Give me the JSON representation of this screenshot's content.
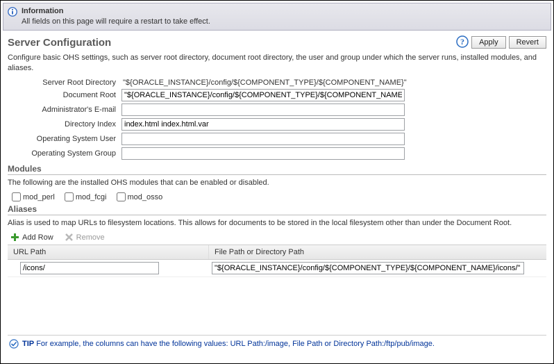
{
  "info": {
    "title": "Information",
    "message": "All fields on this page will require a restart to take effect."
  },
  "header": {
    "title": "Server Configuration",
    "apply": "Apply",
    "revert": "Revert"
  },
  "description": "Configure basic OHS settings, such as server root directory, document root directory, the user and group under which the server runs, installed modules, and aliases.",
  "form": {
    "server_root_label": "Server Root Directory",
    "server_root_value": "\"${ORACLE_INSTANCE}/config/${COMPONENT_TYPE}/${COMPONENT_NAME}\"",
    "doc_root_label": "Document Root",
    "doc_root_value": "\"${ORACLE_INSTANCE}/config/${COMPONENT_TYPE}/${COMPONENT_NAME}\"",
    "admin_email_label": "Administrator's E-mail",
    "admin_email_value": "",
    "dir_index_label": "Directory Index",
    "dir_index_value": "index.html index.html.var",
    "os_user_label": "Operating System User",
    "os_user_value": "",
    "os_group_label": "Operating System Group",
    "os_group_value": ""
  },
  "modules": {
    "header": "Modules",
    "note": "The following are the installed OHS modules that can be enabled or disabled.",
    "items": [
      "mod_perl",
      "mod_fcgi",
      "mod_osso"
    ]
  },
  "aliases": {
    "header": "Aliases",
    "note": "Alias is used to map URLs to filesystem locations. This allows for documents to be stored in the local filesystem other than under the Document Root.",
    "add_row": "Add Row",
    "remove": "Remove",
    "cols": {
      "url": "URL Path",
      "file": "File Path or Directory Path"
    },
    "rows": [
      {
        "url": "/icons/",
        "file": "\"${ORACLE_INSTANCE}/config/${COMPONENT_TYPE}/${COMPONENT_NAME}/icons/\""
      }
    ]
  },
  "tip": {
    "label": "TIP",
    "text": "For example, the columns can have the following values: URL Path:/image, File Path or Directory Path:/ftp/pub/image."
  }
}
